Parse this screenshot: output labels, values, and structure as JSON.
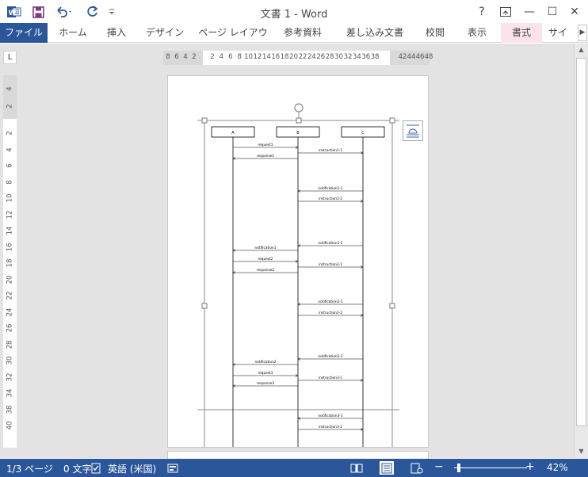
{
  "titlebar": {
    "title": "文書 1 - Word",
    "app_icon": "word-icon",
    "qat_icons": [
      "save-icon",
      "undo-icon",
      "redo-icon",
      "customize-qat-icon"
    ],
    "window_buttons": [
      "help-icon",
      "ribbon-display-icon",
      "minimize-icon",
      "maximize-icon",
      "close-icon"
    ],
    "help": "?",
    "minimize": "—",
    "maximize": "☐",
    "close": "✕"
  },
  "ribbon": {
    "tabs": [
      "ファイル",
      "ホーム",
      "挿入",
      "デザイン",
      "ページ レイアウト",
      "参考資料",
      "差し込み文書",
      "校閲",
      "表示",
      "書式",
      "サイン"
    ],
    "scroll": "▶",
    "colors": {
      "file_tab": "#2b579a",
      "context_tab": "#fbe3ea"
    }
  },
  "ruler": {
    "corner": "L",
    "h_left_ticks": [
      "8",
      "6",
      "4",
      "2"
    ],
    "h_ticks": [
      "2",
      "4",
      "6",
      "8",
      "10",
      "12",
      "14",
      "16",
      "18",
      "20",
      "22",
      "24",
      "26",
      "28",
      "30",
      "32",
      "34",
      "36",
      "38"
    ],
    "h_right_ticks": [
      "42",
      "44",
      "46",
      "48"
    ],
    "v_top_ticks": [
      "4",
      "2"
    ],
    "v_ticks": [
      "2",
      "4",
      "6",
      "8",
      "10",
      "12",
      "14",
      "16",
      "18",
      "20",
      "22",
      "24",
      "26",
      "28",
      "30",
      "32",
      "34",
      "38",
      "40"
    ]
  },
  "diagram": {
    "participants": [
      "A",
      "B",
      "C"
    ],
    "messages": [
      {
        "label": "request1",
        "from": "A",
        "to": "B"
      },
      {
        "label": "response1",
        "from": "B",
        "to": "A"
      },
      {
        "label": "instruction1-1",
        "from": "B",
        "to": "C"
      },
      {
        "label": "notification1-1",
        "from": "C",
        "to": "B"
      },
      {
        "label": "instruction1-2",
        "from": "B",
        "to": "C"
      },
      {
        "label": "notification1-2",
        "from": "C",
        "to": "B"
      },
      {
        "label": "notification1",
        "from": "B",
        "to": "A"
      },
      {
        "label": "request2",
        "from": "A",
        "to": "B"
      },
      {
        "label": "instruction2-1",
        "from": "B",
        "to": "C"
      },
      {
        "label": "response2",
        "from": "B",
        "to": "A"
      },
      {
        "label": "notification2-1",
        "from": "C",
        "to": "B"
      },
      {
        "label": "instruction2-2",
        "from": "B",
        "to": "C"
      },
      {
        "label": "notification2-2",
        "from": "C",
        "to": "B"
      },
      {
        "label": "notification2",
        "from": "B",
        "to": "A"
      },
      {
        "label": "request3",
        "from": "A",
        "to": "B"
      },
      {
        "label": "instruction3-1",
        "from": "B",
        "to": "C"
      },
      {
        "label": "response3",
        "from": "B",
        "to": "A"
      },
      {
        "label": "notification3-1",
        "from": "C",
        "to": "B"
      },
      {
        "label": "instruction3-2",
        "from": "B",
        "to": "C"
      }
    ]
  },
  "status": {
    "page": "1/3 ページ",
    "words": "0 文字",
    "language": "英語 (米国)",
    "zoom": "42%",
    "zoom_minus": "−",
    "zoom_plus": "+",
    "zoom_level": 0.42,
    "icons": [
      "proofing-icon",
      "macro-icon",
      "read-mode-icon",
      "print-layout-icon",
      "web-layout-icon"
    ],
    "color": "#2b579a"
  }
}
